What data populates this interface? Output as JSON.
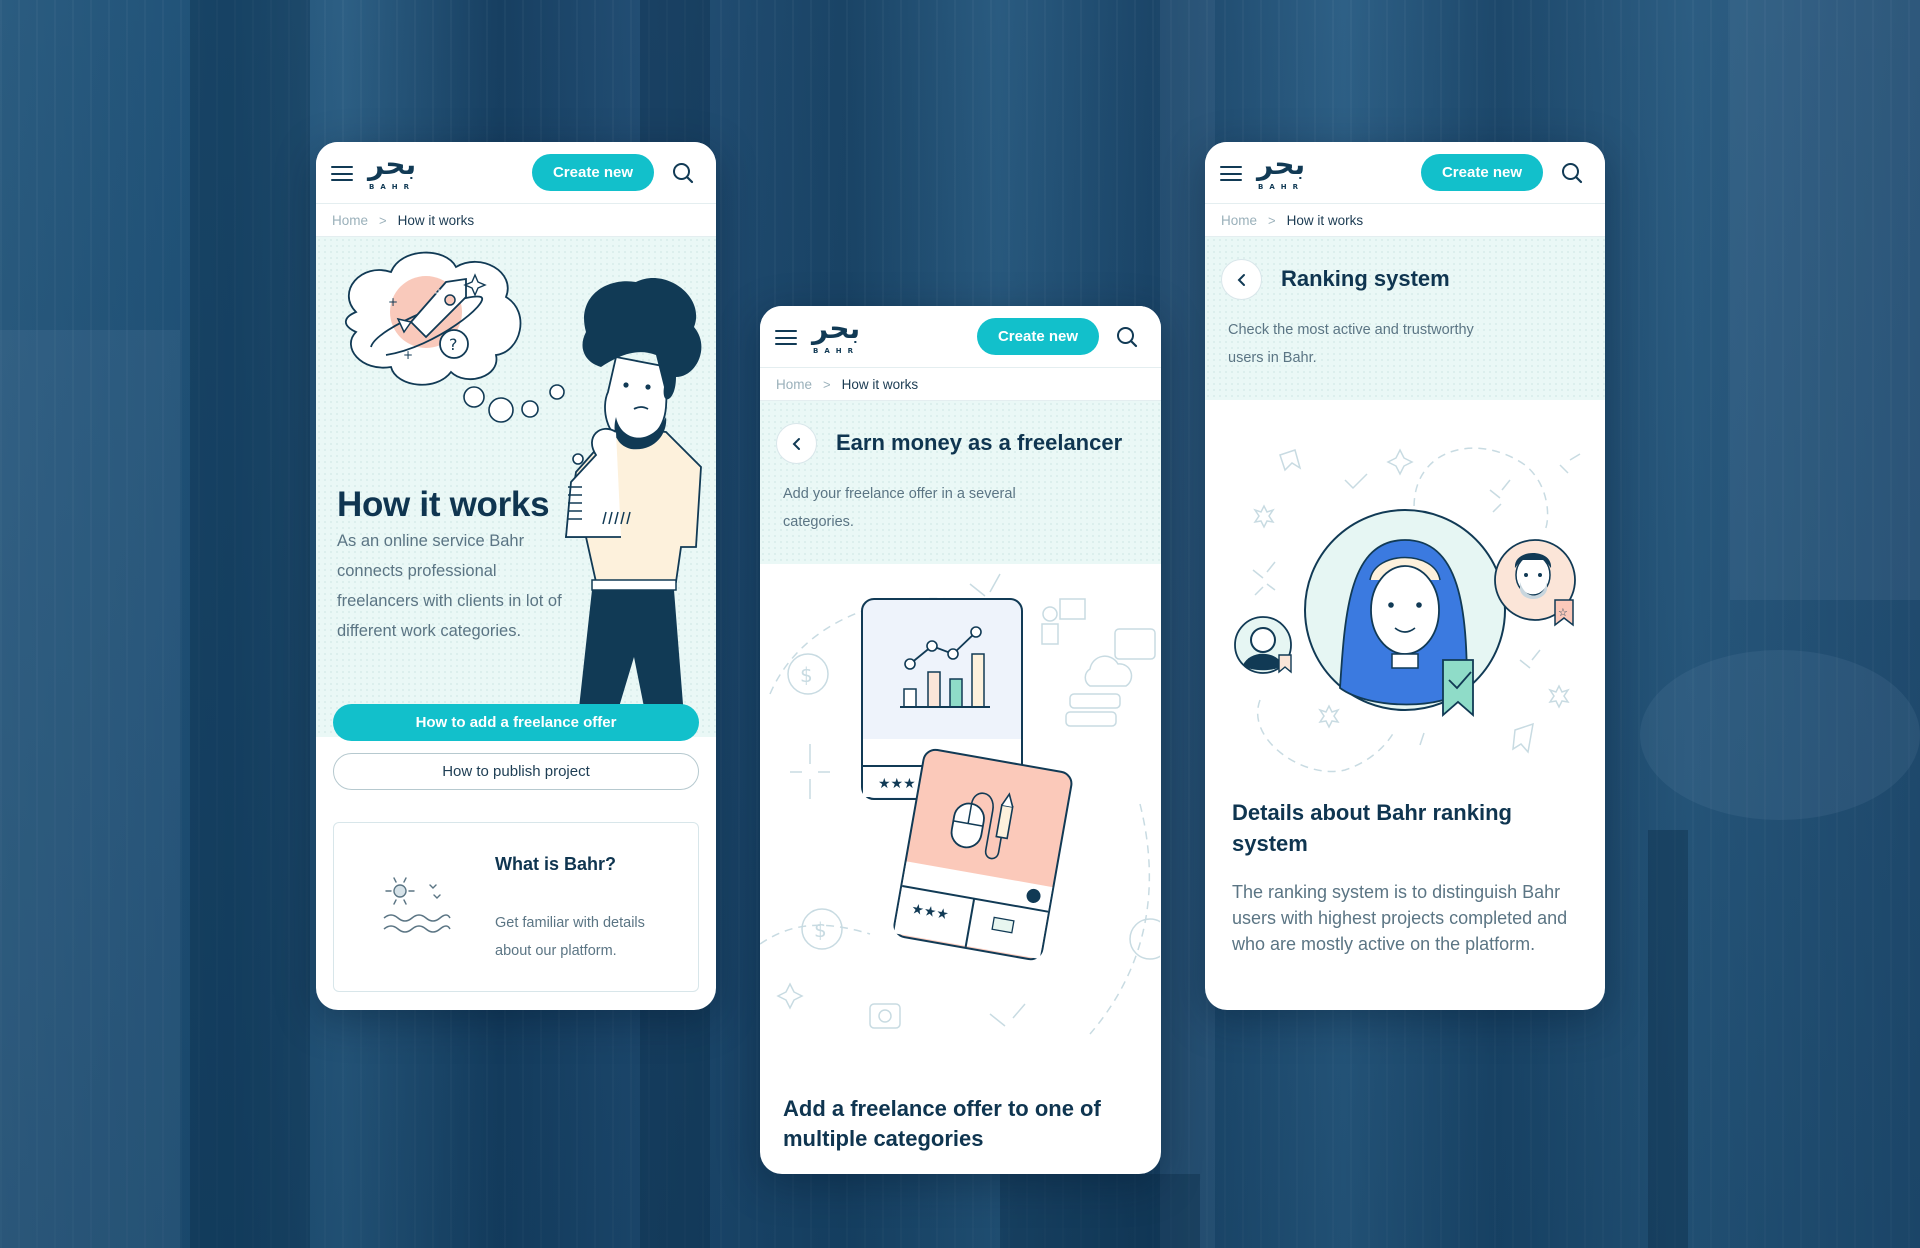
{
  "brand": {
    "logo_arabic": "بحر",
    "logo_latin": "BAHR",
    "primary_color": "#12c0cb",
    "dark_color": "#0f3550",
    "hero_bg_color": "#eaf8f6"
  },
  "header": {
    "create_button_label": "Create new",
    "menu_icon": "hamburger-menu-icon",
    "search_icon": "search-icon"
  },
  "breadcrumb": {
    "home": "Home",
    "separator": ">",
    "current": "How it works"
  },
  "screens": [
    {
      "id": "how-it-works",
      "title": "How it works",
      "description": "As an online service Bahr connects professional freelancers with clients in lot of different work categories.",
      "buttons": [
        {
          "label": "How to add a freelance offer",
          "style": "primary"
        },
        {
          "label": "How to publish project",
          "style": "outline"
        }
      ],
      "info_card": {
        "icon": "sun-and-waves-icon",
        "title": "What is Bahr?",
        "description": "Get familiar with details about our platform."
      },
      "illustration": "thinking-man-rocket-illustration"
    },
    {
      "id": "earn-money",
      "title": "Earn money as a freelancer",
      "description": "Add your freelance offer in a several categories.",
      "back_icon": "chevron-left-icon",
      "illustration": "freelance-offer-cards-illustration",
      "bottom_title": "Add a freelance offer to one of multiple categories"
    },
    {
      "id": "ranking-system",
      "title": "Ranking system",
      "description": "Check the most active and trustworthy users in Bahr.",
      "back_icon": "chevron-left-icon",
      "illustration": "ranked-users-avatars-illustration",
      "details_title": "Details about Bahr ranking system",
      "details_text": "The ranking system is to distinguish Bahr users with highest projects completed and who are mostly active on the platform."
    }
  ]
}
